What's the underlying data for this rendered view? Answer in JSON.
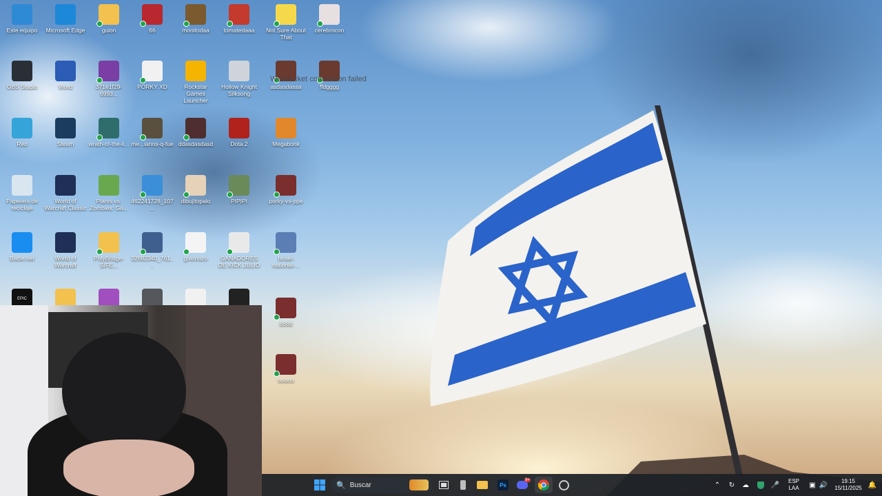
{
  "desktop": {
    "icons": [
      {
        "label": "Este equipo",
        "color": "#2f8ad6",
        "icon": "computer-icon",
        "sync": false
      },
      {
        "label": "Microsoft Edge",
        "color": "#1e88d8",
        "icon": "edge-icon",
        "sync": false
      },
      {
        "label": "guion",
        "color": "#f2c14e",
        "icon": "folder-icon",
        "sync": true
      },
      {
        "label": "66",
        "color": "#b8282e",
        "icon": "image-thumb-icon",
        "sync": true
      },
      {
        "label": "monitodaa",
        "color": "#7a5a2e",
        "icon": "image-thumb-icon",
        "sync": true
      },
      {
        "label": "tomatedaaa",
        "color": "#c43a2c",
        "icon": "image-thumb-icon",
        "sync": true
      },
      {
        "label": "Not Sure About That",
        "color": "#f6d94a",
        "icon": "duck-icon",
        "sync": true
      },
      {
        "label": "cerebrocon",
        "color": "#e8dfe1",
        "icon": "image-thumb-icon",
        "sync": true
      },
      {
        "label": "OBS Studio",
        "color": "#2a2f36",
        "icon": "obs-icon",
        "sync": false
      },
      {
        "label": "Word",
        "color": "#2b5cb6",
        "icon": "word-icon",
        "sync": false
      },
      {
        "label": "371e1f29-6993...",
        "color": "#7a3ea4",
        "icon": "file-icon",
        "sync": true
      },
      {
        "label": "PORKY XD",
        "color": "#f1f1f1",
        "icon": "video-file-icon",
        "sync": true
      },
      {
        "label": "Rockstar Games Launcher",
        "color": "#f4b400",
        "icon": "rockstar-icon",
        "sync": false
      },
      {
        "label": "Hollow Knight Silksong",
        "color": "#cfd4da",
        "icon": "silksong-icon",
        "sync": false
      },
      {
        "label": "asdasdassa",
        "color": "#6a3a2e",
        "icon": "image-thumb-icon",
        "sync": true
      },
      {
        "label": "ffdgggg",
        "color": "#6a3a2e",
        "icon": "image-thumb-icon",
        "sync": true
      },
      {
        "label": "Red",
        "color": "#35a4d9",
        "icon": "network-icon",
        "sync": false
      },
      {
        "label": "Steam",
        "color": "#1b3c5d",
        "icon": "steam-icon",
        "sync": false
      },
      {
        "label": "wrath-of-the-li...",
        "color": "#2f6d6d",
        "icon": "image-thumb-icon",
        "sync": true
      },
      {
        "label": "me...ianos-q-fue",
        "color": "#5a5040",
        "icon": "image-thumb-icon",
        "sync": true
      },
      {
        "label": "ddasdasdasd",
        "color": "#4e2e2e",
        "icon": "image-thumb-icon",
        "sync": true
      },
      {
        "label": "Dota 2",
        "color": "#b0231c",
        "icon": "dota-icon",
        "sync": false
      },
      {
        "label": "Megabonk",
        "color": "#e0882b",
        "icon": "megabonk-icon",
        "sync": false
      },
      {
        "label": "Papelera de reciclaje",
        "color": "#d9e6f0",
        "icon": "recycle-bin-icon",
        "sync": false
      },
      {
        "label": "World of Warcraft Classic",
        "color": "#1f2f55",
        "icon": "wow-icon",
        "sync": false
      },
      {
        "label": "Plants vs. Zombies: Ga...",
        "color": "#6aa84f",
        "icon": "pvz-icon",
        "sync": false
      },
      {
        "label": "462241728_107...",
        "color": "#3a8fd8",
        "icon": "image-thumb-icon",
        "sync": true
      },
      {
        "label": "dibujitopalo",
        "color": "#e6d2b8",
        "icon": "image-thumb-icon",
        "sync": true
      },
      {
        "label": "PIPIPI",
        "color": "#6a8a5a",
        "icon": "image-thumb-icon",
        "sync": true
      },
      {
        "label": "porky-vs-ppe",
        "color": "#7a2e2e",
        "icon": "image-thumb-icon",
        "sync": true
      },
      {
        "label": "Battle.net",
        "color": "#1a8df0",
        "icon": "battlenet-icon",
        "sync": false
      },
      {
        "label": "World of Warcraft",
        "color": "#1f2f55",
        "icon": "wow-icon",
        "sync": false
      },
      {
        "label": "PolyBridge-SIFE...",
        "color": "#f2c14e",
        "icon": "folder-icon",
        "sync": true
      },
      {
        "label": "32682340_761...",
        "color": "#3f5f8f",
        "icon": "image-thumb-icon",
        "sync": true
      },
      {
        "label": "guionazo",
        "color": "#f4f4f4",
        "icon": "document-icon",
        "sync": true
      },
      {
        "label": "GANADORES DE KICK JULIO",
        "color": "#e9e9ea",
        "icon": "image-thumb-icon",
        "sync": true
      },
      {
        "label": "Israel-national-...",
        "color": "#5b7fb4",
        "icon": "image-thumb-icon",
        "sync": true
      },
      {
        "label": "",
        "color": "#111111",
        "icon": "epic-games-icon",
        "sync": false
      },
      {
        "label": "",
        "color": "#f2c14e",
        "icon": "folder-icon",
        "sync": false
      },
      {
        "label": "",
        "color": "#a14fbf",
        "icon": "folder-icon",
        "sync": false
      },
      {
        "label": "",
        "color": "#55575c",
        "icon": "image-thumb-icon",
        "sync": false
      },
      {
        "label": "",
        "color": "#f1f1f1",
        "icon": "video-file-icon",
        "sync": false
      },
      {
        "label": "",
        "color": "#222222",
        "icon": "image-thumb-icon",
        "sync": false
      },
      {
        "label": "8888",
        "color": "#7a2e2e",
        "icon": "image-thumb-icon",
        "sync": true
      },
      {
        "label": "ooooo",
        "color": "#7a2e2e",
        "icon": "image-thumb-icon",
        "sync": true
      }
    ],
    "overlay_message": "Websocket connection failed",
    "epic_label": "EPIC GAMES"
  },
  "taskbar": {
    "search_placeholder": "Buscar",
    "apps": [
      {
        "name": "start-button",
        "icon": "windows-icon"
      },
      {
        "name": "task-view",
        "icon": "task-view-icon"
      },
      {
        "name": "taskbar-app",
        "icon": "app-icon"
      },
      {
        "name": "file-explorer",
        "icon": "folder-icon"
      },
      {
        "name": "photoshop",
        "icon": "photoshop-icon"
      },
      {
        "name": "discord",
        "icon": "discord-icon"
      },
      {
        "name": "chrome",
        "icon": "chrome-icon"
      },
      {
        "name": "steam-taskbar",
        "icon": "steam-icon"
      }
    ],
    "photoshop_label": "Ps",
    "discord_badge": "9+",
    "language": {
      "line1": "ESP",
      "line2": "LAA"
    },
    "time": "19:15",
    "date": "15/11/2025"
  },
  "colors": {
    "taskbar_bg": "#1c2026",
    "accent_blue": "#2a63c9"
  }
}
